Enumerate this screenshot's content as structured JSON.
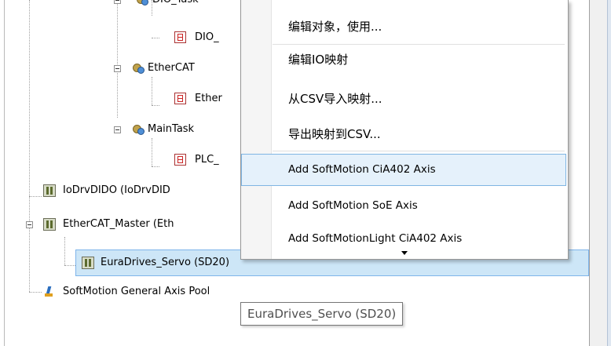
{
  "tree": {
    "items": [
      {
        "label": "DIO_Task",
        "visible_label": "DIO_Task"
      },
      {
        "label": "DIO_"
      },
      {
        "label": "EtherCAT"
      },
      {
        "label": "Ether"
      },
      {
        "label": "MainTask"
      },
      {
        "label": "PLC_"
      },
      {
        "label": "IoDrvDIDO (IoDrvDID"
      },
      {
        "label": "EtherCAT_Master (Eth"
      },
      {
        "label": "EuraDrives_Servo (SD20)"
      },
      {
        "label": "SoftMotion General Axis Pool"
      }
    ]
  },
  "context_menu": {
    "items": [
      {
        "label": "编辑对象，使用..."
      },
      {
        "label": "编辑IO映射"
      },
      {
        "label": "从CSV导入映射..."
      },
      {
        "label": "导出映射到CSV..."
      },
      {
        "label": "Add SoftMotion CiA402 Axis"
      },
      {
        "label": "Add SoftMotion SoE Axis"
      },
      {
        "label": "Add SoftMotionLight CiA402 Axis"
      }
    ]
  },
  "tooltip": {
    "text": "EuraDrives_Servo (SD20)"
  },
  "colors": {
    "selection_bg": "#cde6f7",
    "selection_border": "#7eb4ea",
    "menu_highlight_bg": "#e5f1fb",
    "menu_highlight_border": "#7fb5e3"
  }
}
